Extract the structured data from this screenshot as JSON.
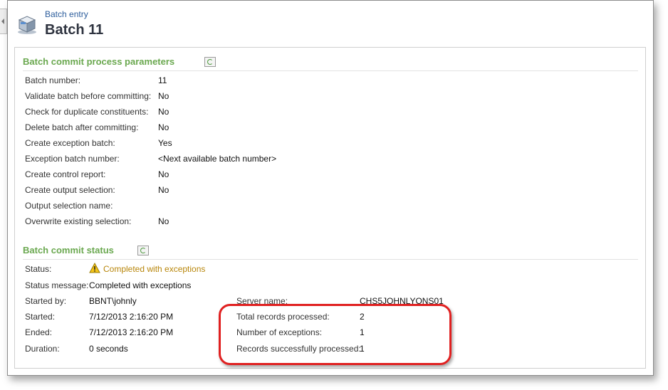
{
  "header": {
    "breadcrumb": "Batch entry",
    "title": "Batch 11"
  },
  "params": {
    "title": "Batch commit process parameters",
    "rows": [
      {
        "label": "Batch number:",
        "value": "11"
      },
      {
        "label": "Validate batch before committing:",
        "value": "No"
      },
      {
        "label": "Check for duplicate constituents:",
        "value": "No"
      },
      {
        "label": "Delete batch after committing:",
        "value": "No"
      },
      {
        "label": "Create exception batch:",
        "value": "Yes"
      },
      {
        "label": "Exception batch number:",
        "value": "<Next available batch number>"
      },
      {
        "label": "Create control report:",
        "value": "No"
      },
      {
        "label": "Create output selection:",
        "value": "No"
      },
      {
        "label": "Output selection name:",
        "value": ""
      },
      {
        "label": "Overwrite existing selection:",
        "value": "No"
      }
    ]
  },
  "status": {
    "title": "Batch commit status",
    "status_label": "Status:",
    "status_value": "Completed with exceptions",
    "message_label": "Status message:",
    "message_value": "Completed with exceptions",
    "left": [
      {
        "label": "Started by:",
        "value": "BBNT\\johnly"
      },
      {
        "label": "Started:",
        "value": "7/12/2013 2:16:20 PM"
      },
      {
        "label": "Ended:",
        "value": "7/12/2013 2:16:20 PM"
      },
      {
        "label": "Duration:",
        "value": "0 seconds"
      }
    ],
    "right": [
      {
        "label": "Server name:",
        "value": "CHS5JOHNLYONS01"
      },
      {
        "label": "Total records processed:",
        "value": "2"
      },
      {
        "label": "Number of exceptions:",
        "value": "1"
      },
      {
        "label": "Records successfully processed:",
        "value": "1"
      }
    ]
  },
  "colors": {
    "section_title": "#6aa84f",
    "status_warning": "#b8860b",
    "highlight": "#e02020",
    "breadcrumb": "#2b5c9b"
  }
}
